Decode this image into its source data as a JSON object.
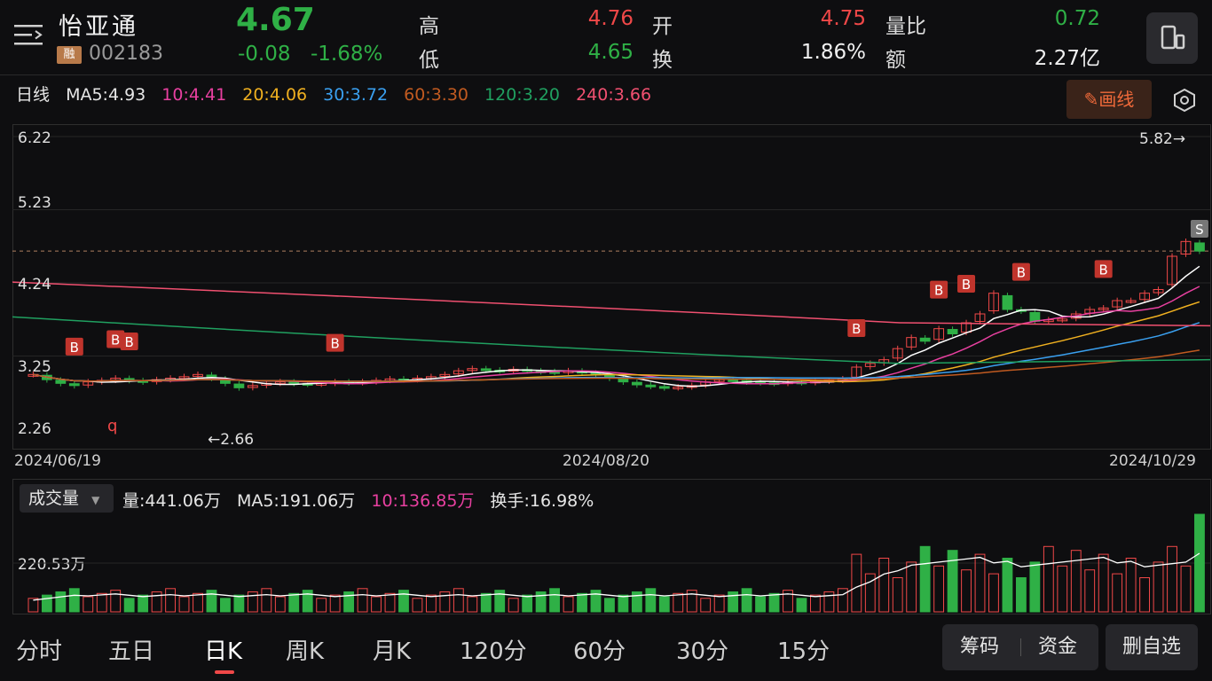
{
  "header": {
    "name": "怡亚通",
    "margin_badge": "融",
    "code": "002183",
    "price": "4.67",
    "change": "-0.08",
    "change_pct": "-1.68%",
    "high_label": "高",
    "high": "4.76",
    "low_label": "低",
    "low": "4.65",
    "open_label": "开",
    "open": "4.75",
    "turnover_label": "换",
    "turnover": "1.86%",
    "vol_ratio_label": "量比",
    "vol_ratio": "0.72",
    "amount_label": "额",
    "amount": "2.27亿"
  },
  "ma_bar": {
    "period": "日线",
    "ma5": "MA5:4.93",
    "ma10": "10:4.41",
    "ma20": "20:4.06",
    "ma30": "30:3.72",
    "ma60": "60:3.30",
    "ma120": "120:3.20",
    "ma240": "240:3.66",
    "draw_label": "画线",
    "colors": {
      "ma5": "#ffffff",
      "ma10": "#e840a0",
      "ma20": "#f0b020",
      "ma30": "#3aa0f0",
      "ma60": "#c05a20",
      "ma120": "#20a060",
      "ma240": "#f05070"
    }
  },
  "price_axis": {
    "ticks": [
      "6.22",
      "5.23",
      "4.24",
      "3.25",
      "2.26"
    ],
    "max_label": "5.82→",
    "min_label": "←2.66",
    "marker_q": "q"
  },
  "dates": [
    "2024/06/19",
    "2024/08/20",
    "2024/10/29"
  ],
  "signals": {
    "buy": "B",
    "sell": "S"
  },
  "volume": {
    "selector": "成交量",
    "vol": "量:441.06万",
    "ma5": "MA5:191.06万",
    "ma10": "10:136.85万",
    "turnover": "换手:16.98%",
    "axis_label": "220.53万"
  },
  "tabs": [
    "分时",
    "五日",
    "日K",
    "周K",
    "月K",
    "120分",
    "60分",
    "30分",
    "15分"
  ],
  "active_tab": "日K",
  "actions": {
    "chips": "筹码",
    "funds": "资金",
    "remove": "删自选"
  },
  "colors": {
    "up": "#f04848",
    "down": "#2fb046",
    "bg": "#0e0e10"
  },
  "chart_data": {
    "type": "candlestick",
    "y_range": [
      2.26,
      6.22
    ],
    "series_close": [
      3.0,
      2.93,
      2.88,
      2.85,
      2.9,
      2.92,
      2.95,
      2.92,
      2.9,
      2.93,
      2.95,
      2.97,
      3.0,
      2.95,
      2.88,
      2.82,
      2.85,
      2.88,
      2.9,
      2.88,
      2.87,
      2.88,
      2.9,
      2.89,
      2.9,
      2.92,
      2.94,
      2.93,
      2.95,
      2.97,
      3.0,
      3.05,
      3.08,
      3.06,
      3.05,
      3.07,
      3.05,
      3.04,
      3.03,
      3.05,
      3.02,
      3.0,
      2.95,
      2.9,
      2.86,
      2.84,
      2.82,
      2.83,
      2.85,
      2.9,
      2.93,
      2.92,
      2.9,
      2.89,
      2.88,
      2.9,
      2.89,
      2.91,
      2.92,
      2.94,
      3.1,
      3.15,
      3.2,
      3.35,
      3.5,
      3.45,
      3.62,
      3.55,
      3.7,
      3.82,
      4.1,
      3.88,
      3.86,
      3.72,
      3.74,
      3.75,
      3.82,
      3.88,
      3.9,
      4.0,
      4.0,
      4.1,
      4.15,
      4.6,
      4.8,
      4.67
    ],
    "ma_last": {
      "MA5": 4.93,
      "MA10": 4.41,
      "MA20": 4.06,
      "MA30": 3.72,
      "MA60": 3.3,
      "MA120": 3.2,
      "MA240": 3.66
    },
    "volume_last_wan": 441.06
  }
}
